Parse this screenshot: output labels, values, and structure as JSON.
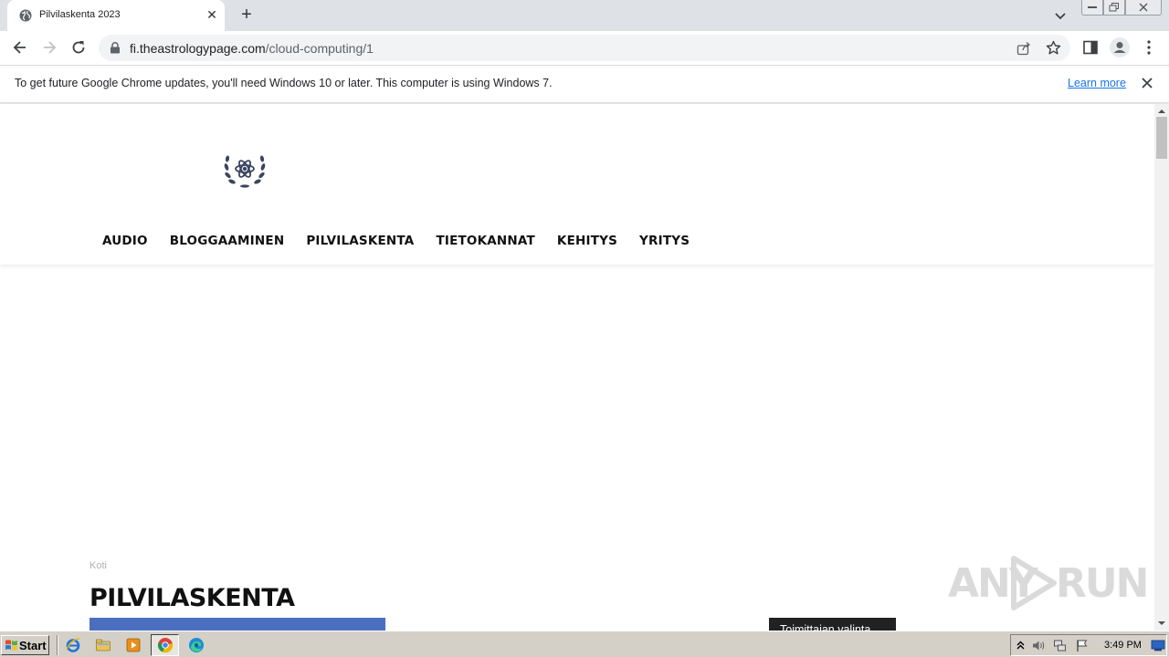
{
  "browser": {
    "tab_title": "Pilvilaskenta 2023",
    "url_host": "fi.theastrologypage.com",
    "url_path": "/cloud-computing/1"
  },
  "infobar": {
    "message": "To get future Google Chrome updates, you'll need Windows 10 or later. This computer is using Windows 7.",
    "link": "Learn more"
  },
  "site": {
    "nav": [
      "AUDIO",
      "BLOGGAAMINEN",
      "PILVILASKENTA",
      "TIETOKANNAT",
      "KEHITYS",
      "YRITYS"
    ],
    "breadcrumb": "Koti",
    "title": "PILVILASKENTA",
    "editors_pick": "Toimittajan valinta"
  },
  "watermark": {
    "left": "ANY",
    "right": "RUN"
  },
  "taskbar": {
    "start_label": "Start",
    "clock": "3:49 PM",
    "pinned": [
      "internet-explorer-icon",
      "file-explorer-icon",
      "media-player-icon",
      "chrome-icon",
      "edge-icon"
    ]
  },
  "colors": {
    "tabstrip": "#dee1e6",
    "link": "#1a73e8",
    "logo": "#3a4460",
    "feature_image": "#4a6fbf",
    "taskbar": "#d4d0c8"
  }
}
